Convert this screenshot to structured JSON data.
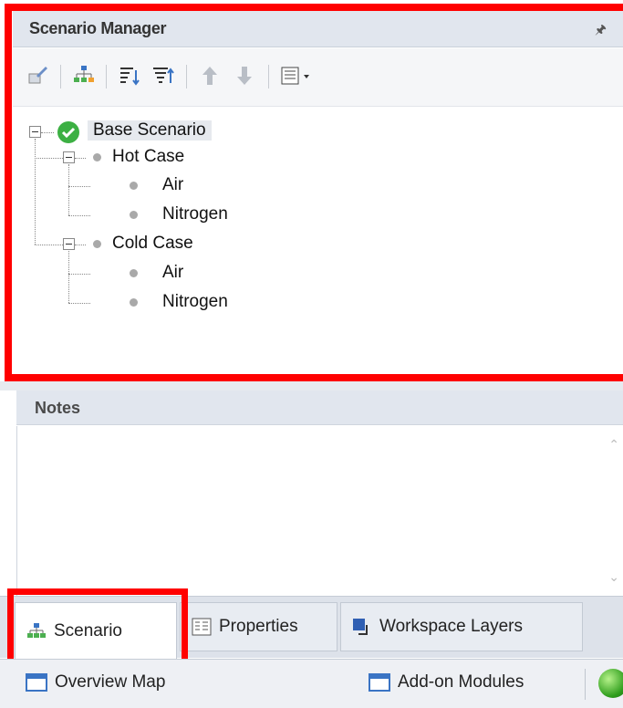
{
  "scenario_manager": {
    "title": "Scenario Manager",
    "pin_icon": "pin-icon",
    "toolbar": {
      "buttons": [
        "edit-scenario-icon",
        "create-child-icon",
        "sort-icon",
        "filter-icon",
        "move-up-icon",
        "move-down-icon",
        "view-options-icon"
      ]
    },
    "tree": {
      "root": "Base Scenario",
      "children": [
        {
          "label": "Hot Case",
          "children": [
            "Air",
            "Nitrogen"
          ]
        },
        {
          "label": "Cold Case",
          "children": [
            "Air",
            "Nitrogen"
          ]
        }
      ]
    }
  },
  "notes": {
    "title": "Notes"
  },
  "tabs": [
    {
      "label": "Scenario",
      "active": true
    },
    {
      "label": "Properties",
      "active": false
    },
    {
      "label": "Workspace Layers",
      "active": false
    }
  ],
  "bottom_bar": {
    "overview": "Overview Map",
    "addons": "Add-on Modules"
  },
  "colors": {
    "highlight": "#ff0000",
    "accent": "#3a74c4",
    "status_green": "#2e9d1c"
  }
}
